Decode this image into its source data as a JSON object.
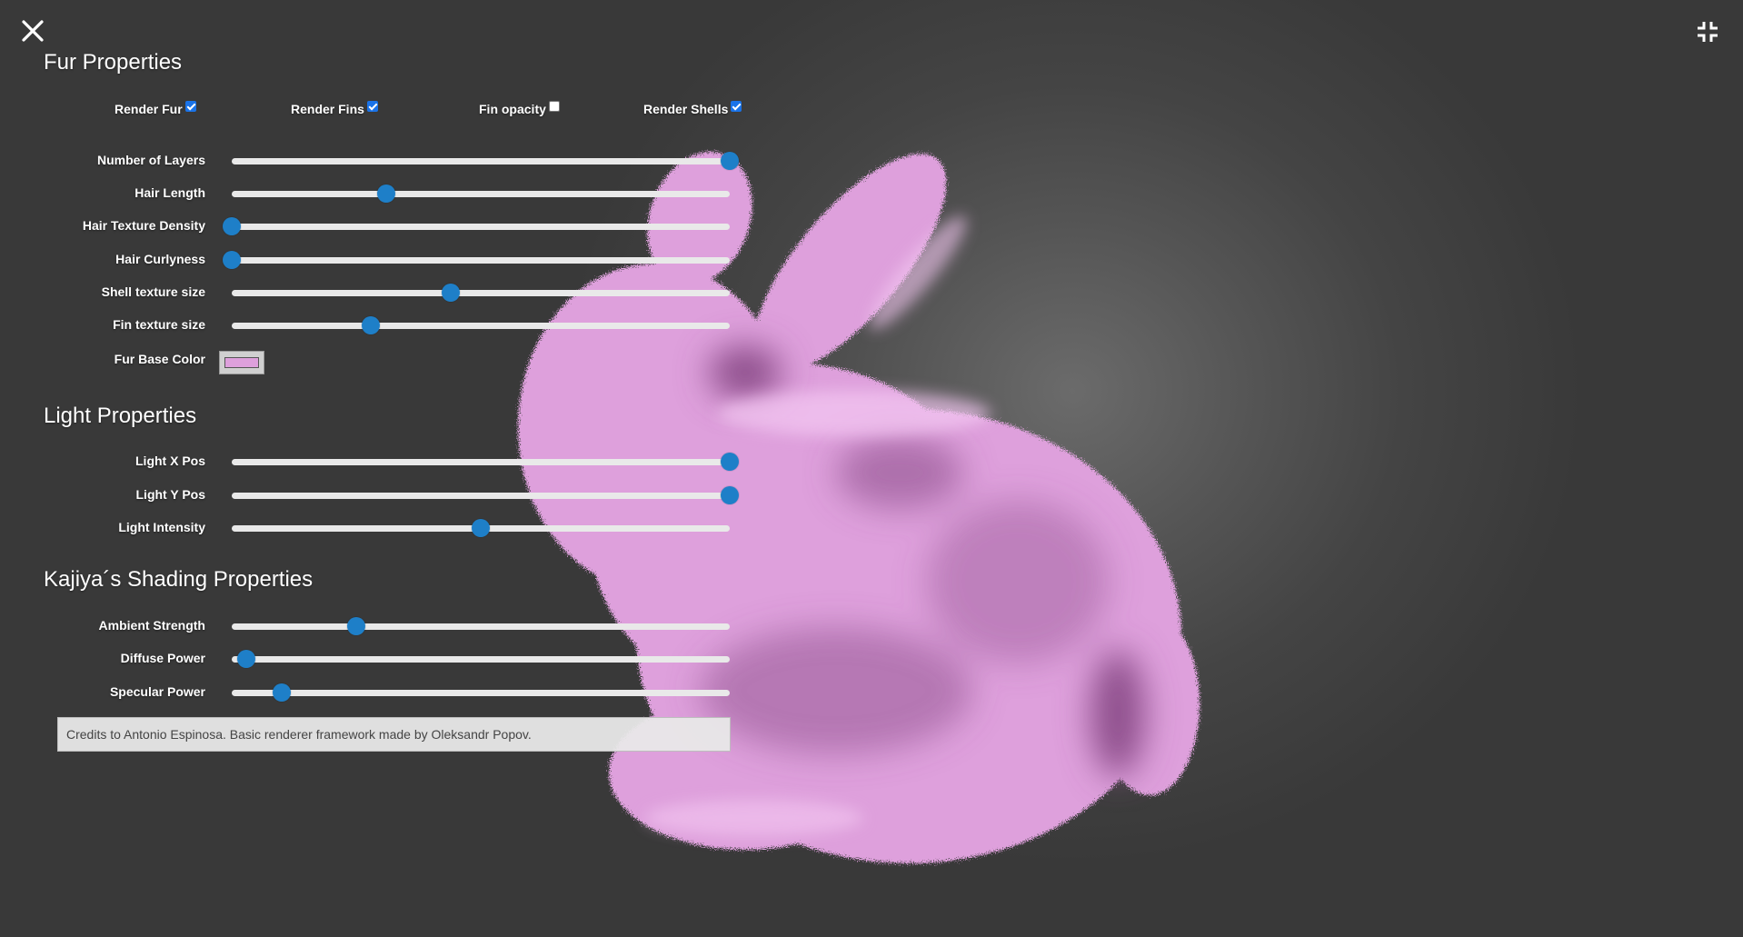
{
  "colors": {
    "accent": "#1e7fc8",
    "fur_base": "#dea0dc",
    "fur_light": "#f4c8f2",
    "fur_dark": "#8e4f8c"
  },
  "icons": {
    "close": "close-icon",
    "collapse": "collapse-icon"
  },
  "fur": {
    "title": "Fur Properties",
    "checkboxes": [
      {
        "label": "Render Fur",
        "checked": true
      },
      {
        "label": "Render Fins",
        "checked": true
      },
      {
        "label": "Fin opacity",
        "checked": false
      },
      {
        "label": "Render Shells",
        "checked": true
      }
    ],
    "sliders": [
      {
        "label": "Number of Layers",
        "value": 1.0
      },
      {
        "label": "Hair Length",
        "value": 0.31
      },
      {
        "label": "Hair Texture Density",
        "value": 0.0
      },
      {
        "label": "Hair Curlyness",
        "value": 0.0
      },
      {
        "label": "Shell texture size",
        "value": 0.44
      },
      {
        "label": "Fin texture size",
        "value": 0.28
      }
    ],
    "base_color_label": "Fur Base Color"
  },
  "light": {
    "title": "Light Properties",
    "sliders": [
      {
        "label": "Light X Pos",
        "value": 1.0
      },
      {
        "label": "Light Y Pos",
        "value": 1.0
      },
      {
        "label": "Light Intensity",
        "value": 0.5
      }
    ]
  },
  "shading": {
    "title": "Kajiya´s Shading Properties",
    "sliders": [
      {
        "label": "Ambient Strength",
        "value": 0.25
      },
      {
        "label": "Diffuse Power",
        "value": 0.03
      },
      {
        "label": "Specular Power",
        "value": 0.1
      }
    ]
  },
  "credits": "Credits to Antonio Espinosa. Basic renderer framework made by Oleksandr Popov."
}
